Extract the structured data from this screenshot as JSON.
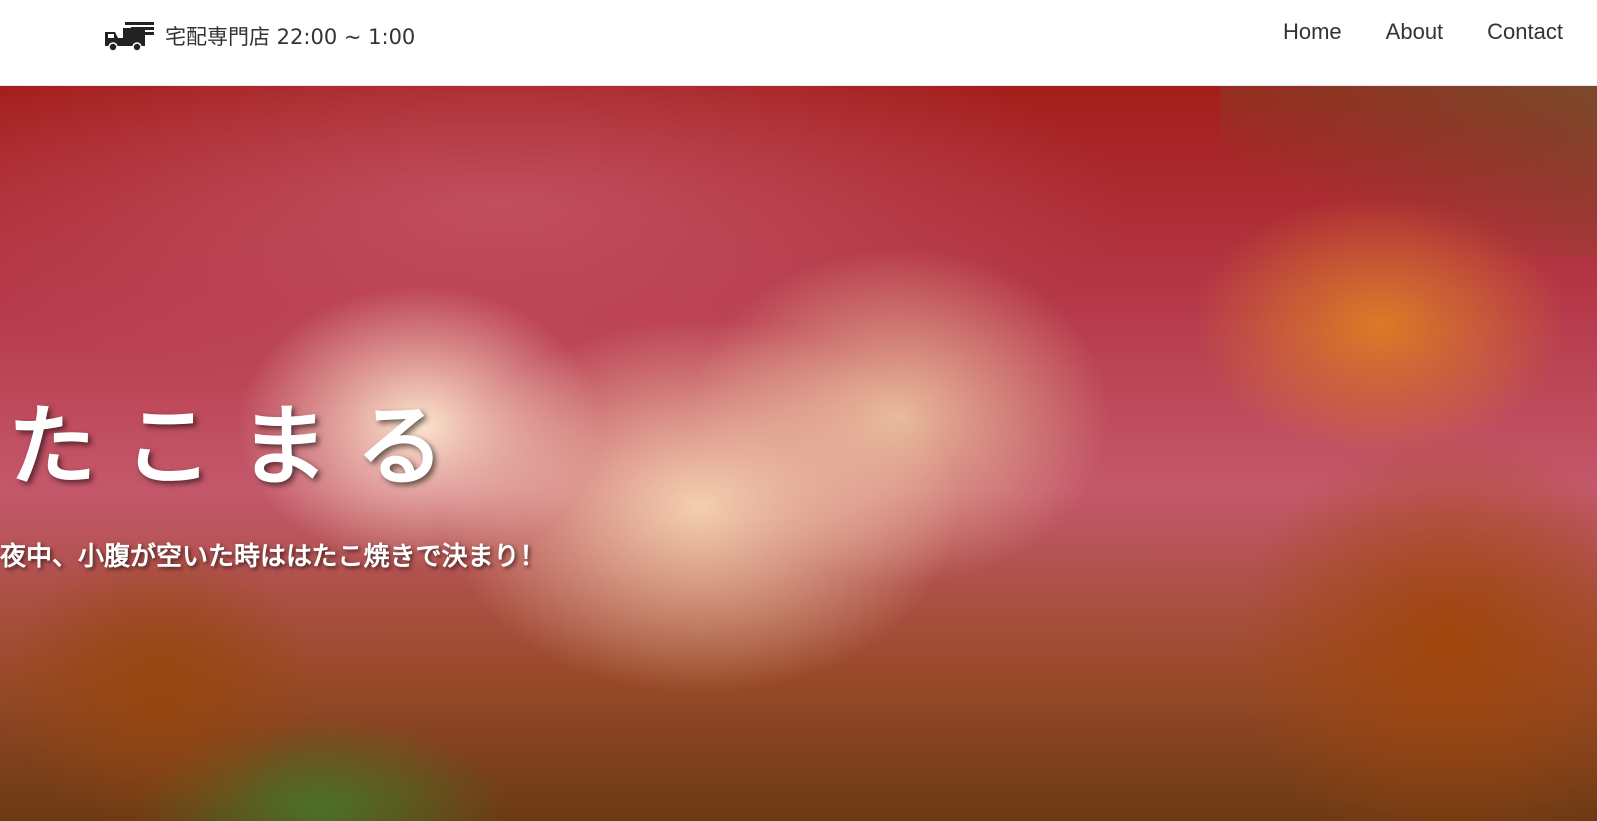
{
  "header": {
    "brand_icon": "delivery-truck-icon",
    "brand_text": "宅配専門店 22:00 ~ 1:00",
    "nav": {
      "home": "Home",
      "about": "About",
      "contact": "Contact"
    }
  },
  "hero": {
    "image": "takoyaki-photo",
    "title": "たこまる",
    "subtitle": "夜中、小腹が空いた時ははたこ焼きで決まり！"
  },
  "colors": {
    "header_bg": "#ffffff",
    "nav_text": "#333333",
    "hero_text": "#ffffff"
  }
}
